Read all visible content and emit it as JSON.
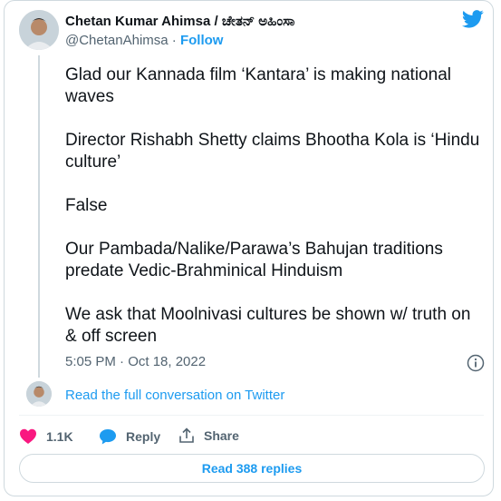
{
  "author": {
    "name": "Chetan Kumar Ahimsa / ಚೇತನ್ ಅಹಿಂಸಾ",
    "handle": "@ChetanAhimsa",
    "separator": "·",
    "follow_label": "Follow"
  },
  "tweet": {
    "paragraphs": [
      "Glad our Kannada film ‘Kantara’ is making national waves",
      "Director Rishabh Shetty claims Bhootha Kola is ‘Hindu culture’",
      "False",
      "Our Pambada/Nalike/Parawa’s Bahujan traditions predate Vedic-Brahminical Hinduism",
      "We ask that Moolnivasi cultures be shown w/ truth on & off screen"
    ],
    "timestamp": "5:05 PM · Oct 18, 2022"
  },
  "conversation_link": "Read the full conversation on Twitter",
  "actions": {
    "likes": "1.1K",
    "reply_label": "Reply",
    "share_label": "Share"
  },
  "read_replies_label": "Read 388 replies",
  "colors": {
    "accent": "#1d9bf0",
    "like": "#f91880",
    "secondary_text": "#536471",
    "border": "#cfd9de"
  },
  "icons": [
    "twitter-bird-icon",
    "info-icon",
    "heart-icon",
    "reply-bubble-icon",
    "share-icon"
  ]
}
